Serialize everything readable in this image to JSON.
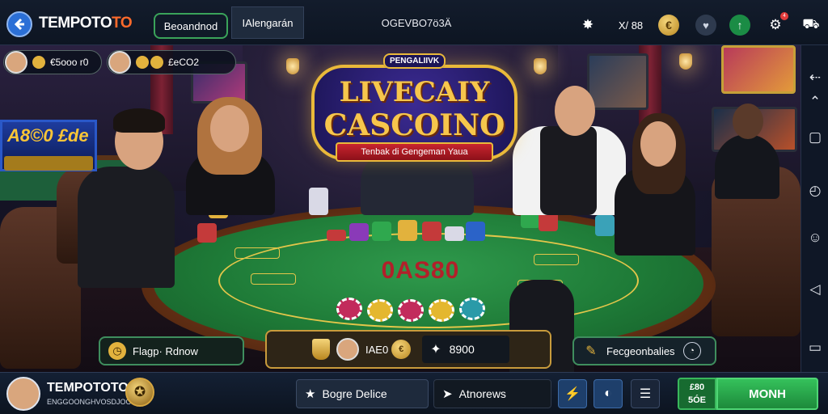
{
  "header": {
    "brand_main": "TEMPOTO",
    "brand_accent": "TO",
    "tabs": [
      {
        "label": "Beoandnod"
      },
      {
        "label": "IAlengarán"
      },
      {
        "label": "OGEVBO7ö3Ä"
      }
    ],
    "icons": [
      "back-arrow-icon",
      "star-burst-icon",
      "x-chart-icon",
      "coin-icon",
      "shield-icon",
      "green-up-icon",
      "settings-icon",
      "cart-icon"
    ],
    "x_label": "X/ 88",
    "coin_symbol": "€",
    "notif_badge": "4"
  },
  "overlay": {
    "player1_amount": "€5ooo r0",
    "player2_amount": "£eCO2",
    "jackpot_text": "A8©0 £de"
  },
  "logo": {
    "kicker": "PENGALIIVK",
    "line1": "LIVECAIY",
    "line2": "CASCOINO",
    "ribbon": "Tenbak di Gengeman Yaua"
  },
  "table": {
    "felt_text": "0AS80"
  },
  "scene_controls": {
    "left_label": "Flagp· Rdnow",
    "center_label": "IAE0",
    "center_amount": "8900",
    "right_label": "Fecgeonbalies"
  },
  "rail": {
    "icons": [
      "arrow-left-icon",
      "chevron-up-icon",
      "square-icon",
      "timer-icon",
      "emoji-icon",
      "triangle-left-icon",
      "chat-icon"
    ]
  },
  "footer": {
    "user_name": "TEMPOTOTO",
    "user_sub": "ENGGOONGHVOSDJOOD",
    "btn1_label": "Bogre Delice",
    "btn2_label": "Atnorews",
    "amount_line1": "£80",
    "amount_line2": "5ÓE",
    "action_label": "MONH"
  },
  "colors": {
    "accent_orange": "#ff6a2b",
    "felt_green": "#1e7a37",
    "gold": "#e9b93a",
    "action_green": "#2fb352"
  }
}
